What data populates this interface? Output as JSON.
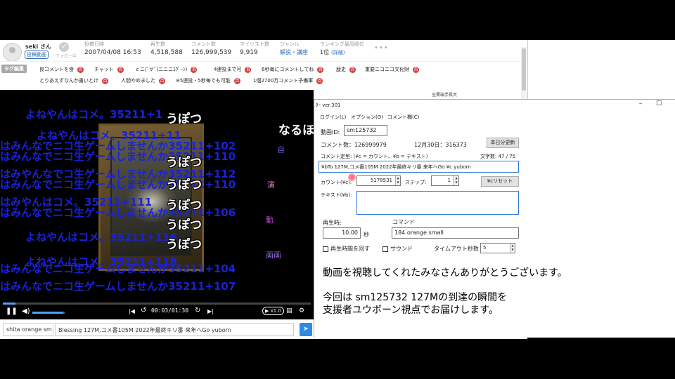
{
  "video_info": {
    "username": "seki さん",
    "user_badge": "投稿動画",
    "follow_label": "フォロー中",
    "stats": [
      {
        "label": "投稿日時",
        "value": "2007/04/08 16:53"
      },
      {
        "label": "再生数",
        "value": "4,518,588"
      },
      {
        "label": "コメント数",
        "value": "126,999,539"
      },
      {
        "label": "マイリスト数",
        "value": "9,919"
      },
      {
        "label": "ジャンル",
        "value": "解説・講座"
      },
      {
        "label": "ランキング最高順位",
        "value": "1位",
        "link": "(詳細)"
      }
    ],
    "more": "•••"
  },
  "tags": {
    "edit_label": "タグ編集",
    "items": [
      {
        "label": "良コメントを食",
        "dic": "百"
      },
      {
        "label": "チャット",
        "dic": "百"
      },
      {
        "label": "ｃニ(ﾟ∀ﾟ)ニニニｺｳﾞｰﾝ)",
        "dic": "百"
      },
      {
        "label": "4連投まで可",
        "dic": "百"
      },
      {
        "label": "6秒毎にコメントしてね",
        "dic": "百"
      },
      {
        "label": "歴史",
        "dic": "百"
      },
      {
        "label": "重要ニコニコ文化財",
        "dic": "百"
      },
      {
        "label": "とりあえずなんか書いとけ",
        "dic": "百"
      },
      {
        "label": "人間やめました",
        "dic": "百"
      },
      {
        "label": "※5連投・5秒毎でも可能",
        "dic": "百"
      },
      {
        "label": "1個2700万コメント予備軍",
        "dic": "百"
      }
    ]
  },
  "player": {
    "comments_blue": [
      "よねやんはコメ。35211+1",
      "よねやんはコメ。35211+11",
      "はみんなでニコ生ゲームしませんか35211+102",
      "はみんなでニコ生ゲームしませんか35211+110",
      "はみやんなでコ生ゲームしませんか35211+112",
      "はみんなでニコ生ゲームしませんか35211+110",
      "はみやんはコメ。35211+111",
      "はみんなでニコ生ゲームしませんか35211+106",
      "よねやんはコメ。35211+116",
      "よねやんはコメ。35211+118",
      "はみんなでニコ生ゲームしませんか35211+104",
      "はみんなでニコ生ゲームしませんか35211+107"
    ],
    "comments_white": [
      "うぽつ",
      "うぽつ",
      "うぽつ",
      "うぽつ",
      "うぽつ",
      "うぽつ",
      "なるほ"
    ],
    "side_comments": [
      "自",
      "演",
      "動",
      "画画"
    ],
    "time_current": "00:03",
    "time_total": "01:30",
    "time_sep": "/",
    "speed": "x1.0",
    "progress": 0.04,
    "volume": 0.95
  },
  "comment_bar": {
    "command_value": "shita orange sm",
    "comment_value": "Blessing 127M,コメ番105M 2022年最終キリ番 来年へGo yuborn",
    "send_icon": "send-icon"
  },
  "app": {
    "title": "ﾀｰ ver.301",
    "menus": [
      "ログイン(L)",
      "オプション(O)",
      "コメント欄(C)"
    ],
    "video_id_label": "動画ID:",
    "video_id_value": "sm125732",
    "comment_count_label": "コメント数：126999979",
    "date_info": "12月30日：316373",
    "refresh_btn": "本日分更新",
    "template_label": "コメント定型: (¥c = カウント、¥b = テキスト)",
    "char_count": "文字数: 47 / 75",
    "template_value": "¥bTo 127M,コメ番105M 2022年最終キリ番 来年へGo ¥c yuborn",
    "count_label": "カウント(¥c):",
    "count_value": "5178531",
    "step_label": "ステップ:",
    "step_value": "1",
    "reset_btn": "¥cリセット",
    "text_label": "テキスト(¥b):",
    "text_value": "",
    "play_time_label": "再生時:",
    "play_time_value": "10.00",
    "play_time_unit": "秒",
    "command_label": "コマンド",
    "command_value": "184 orange small",
    "chk_loop": "再生時間を回す",
    "chk_sound": "サウンド",
    "timeout_label": "タイムアウト秒数",
    "timeout_value": "5",
    "message_lines": [
      "動画を視聴してくれたみなさんありがとうございます。",
      "今回は sm125732 127Mの到達の瞬間を",
      "支援者ユウボーン視点でお届けします。"
    ]
  },
  "toolbar_peek": [
    "全異端手長大"
  ]
}
